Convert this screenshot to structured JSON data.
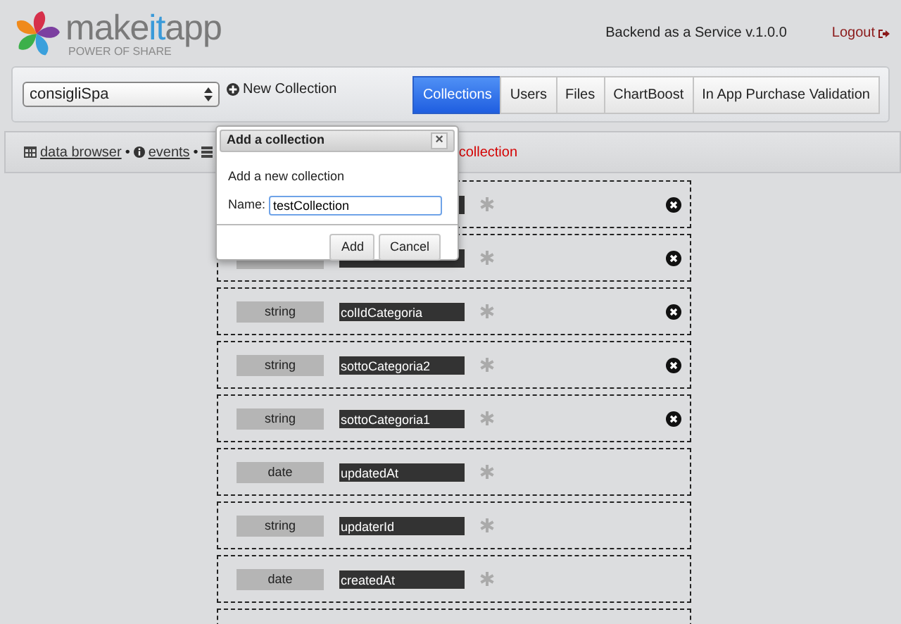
{
  "header": {
    "logo_parts": [
      {
        "text": "make",
        "color": "#7a7a7a"
      },
      {
        "text": "it",
        "color": "#3a9ad9"
      },
      {
        "text": "app",
        "color": "#7a7a7a"
      }
    ],
    "tagline": "POWER OF SHARE",
    "service": "Backend as a Service v.1.0.0",
    "logout": "Logout"
  },
  "toolbar": {
    "app_select": "consigliSpa",
    "new_collection": "New Collection",
    "tabs": [
      {
        "label": "Collections",
        "selected": true
      },
      {
        "label": "Users",
        "selected": false
      },
      {
        "label": "Files",
        "selected": false
      },
      {
        "label": "ChartBoost",
        "selected": false
      },
      {
        "label": "In App Purchase Validation",
        "selected": false
      }
    ]
  },
  "breadcrumb": [
    {
      "kind": "grid",
      "label": "data browser",
      "separator": "•"
    },
    {
      "kind": "info",
      "label": "events",
      "separator": "•"
    },
    {
      "kind": "list"
    },
    {
      "kind": "current",
      "label": "collection"
    }
  ],
  "fields": [
    {
      "removable": true
    },
    {
      "kind": "partial",
      "removable": true
    },
    {
      "type": "string",
      "name": "colIdCategoria",
      "removable": true
    },
    {
      "type": "string",
      "name": "sottoCategoria2",
      "removable": true
    },
    {
      "type": "string",
      "name": "sottoCategoria1",
      "removable": true
    },
    {
      "type": "date",
      "name": "updatedAt",
      "removable": false
    },
    {
      "type": "string",
      "name": "updaterId",
      "removable": false
    },
    {
      "type": "date",
      "name": "createdAt",
      "removable": false
    },
    {
      "removable": false
    }
  ],
  "dialog": {
    "title": "Add a collection",
    "close": "×",
    "intro": "Add a new collection",
    "name_label": "Name:",
    "name_value": "testCollection",
    "buttons": [
      "Add",
      "Cancel"
    ]
  }
}
